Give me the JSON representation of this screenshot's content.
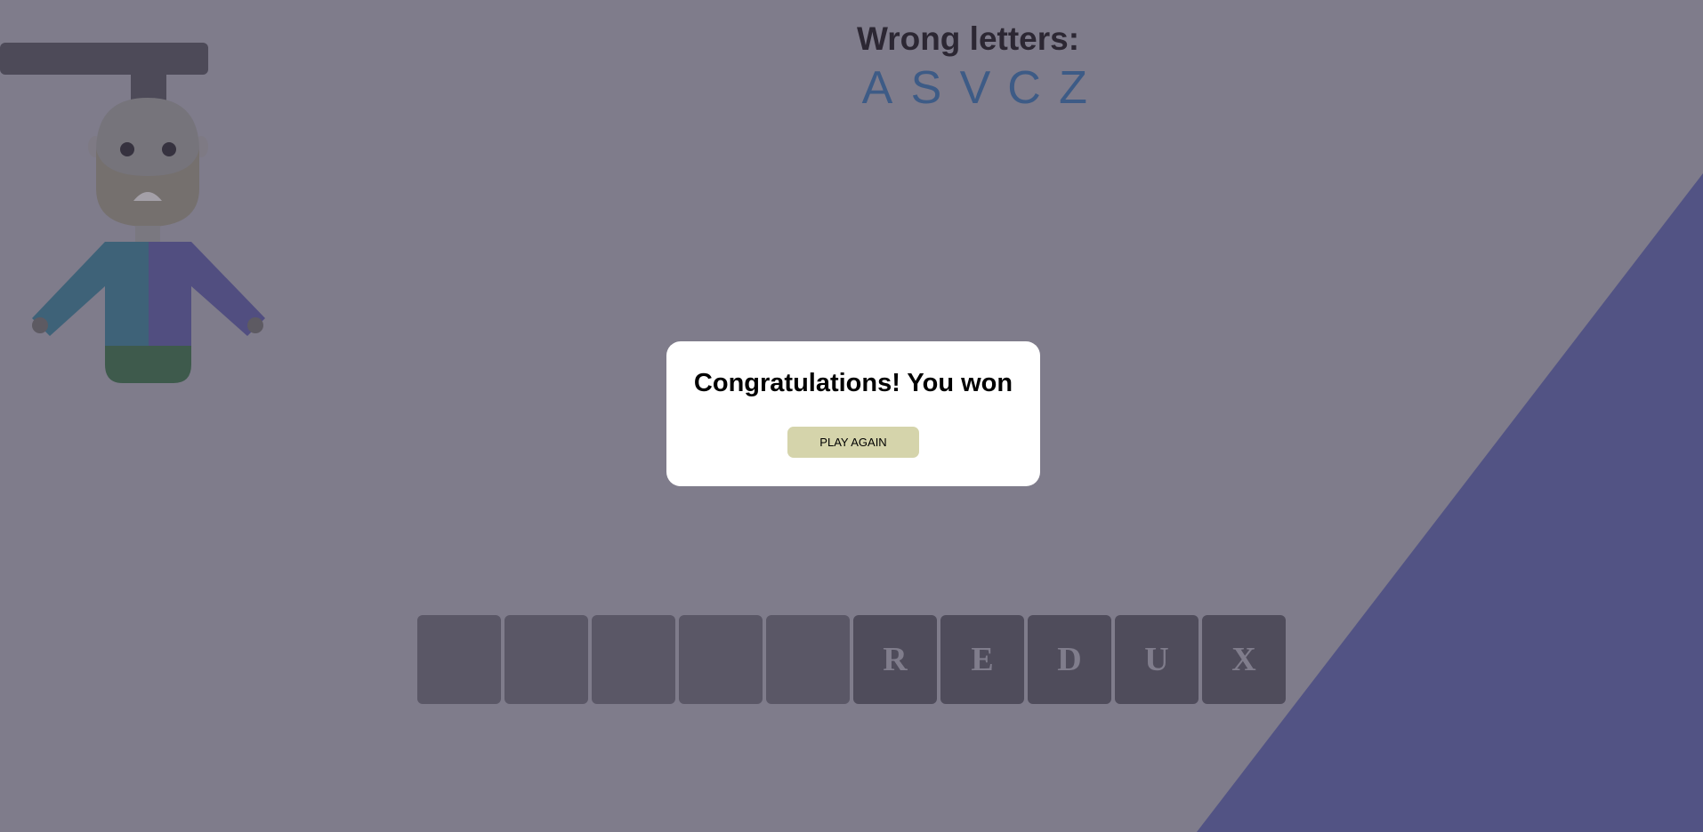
{
  "colors": {
    "background": "#7f7c8b",
    "diagonal_accent": "#525384",
    "wrong_title": "#2c2733",
    "wrong_letters": "#3d5b86",
    "modal_bg": "#ffffff",
    "play_button_bg": "#d5d4ab"
  },
  "wrong": {
    "title": "Wrong letters:",
    "letters": [
      "A",
      "S",
      "V",
      "C",
      "Z"
    ]
  },
  "word": {
    "tiles": [
      "",
      "",
      "",
      "",
      "",
      "R",
      "E",
      "D",
      "U",
      "X"
    ]
  },
  "modal": {
    "message": "Congratulations! You won",
    "button_label": "PLAY AGAIN"
  },
  "hangman": {
    "parts": [
      "gallows-beam",
      "rope",
      "head",
      "beard",
      "eyes",
      "mouth",
      "neck",
      "left-arm",
      "right-arm",
      "torso",
      "legs"
    ]
  }
}
